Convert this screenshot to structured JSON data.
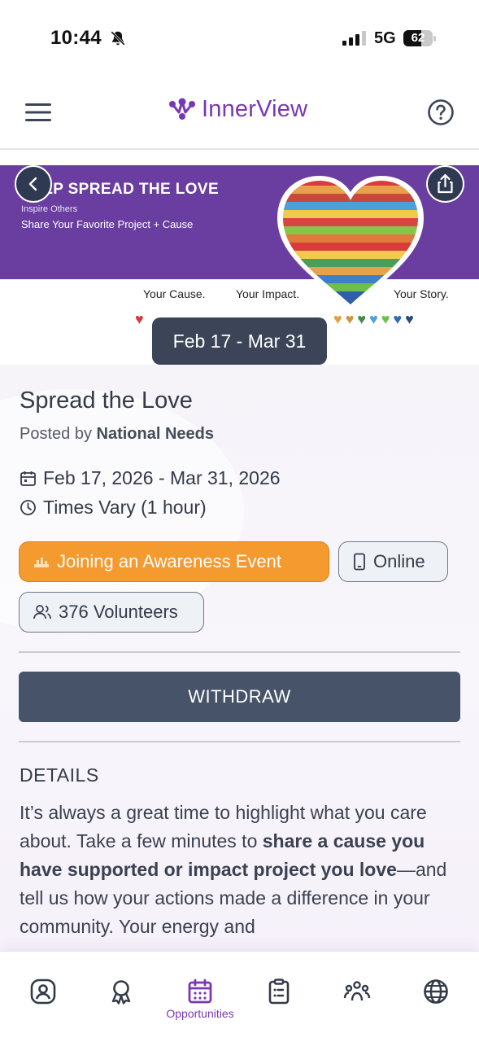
{
  "status_bar": {
    "time": "10:44",
    "network": "5G",
    "battery": "62"
  },
  "header": {
    "brand_name": "InnerView"
  },
  "hero": {
    "title": "HELP SPREAD THE LOVE",
    "subtitle": "Inspire Others",
    "tagline": "Share Your Favorite Project + Cause",
    "cause": "Your Cause.",
    "impact": "Your Impact.",
    "story": "Your Story."
  },
  "date_badge": "Feb 17 - Mar 31",
  "opportunity": {
    "title": "Spread the Love",
    "posted_prefix": "Posted by",
    "organization": "National Needs",
    "date_range": "Feb 17, 2026 - Mar 31, 2026",
    "time": "Times Vary (1 hour)",
    "category": "Joining an Awareness Event",
    "location": "Online",
    "volunteers": "376 Volunteers"
  },
  "actions": {
    "withdraw": "WITHDRAW"
  },
  "details": {
    "heading": "DETAILS",
    "p1": "It’s always a great time to highlight what you care about. Take a few minutes to ",
    "b1": "share a cause you have supported or impact project you love",
    "p2": "—and tell us how your actions made a difference in your community. Your energy and"
  },
  "nav": {
    "items": [
      {
        "icon": "profile-icon",
        "label": ""
      },
      {
        "icon": "award-icon",
        "label": ""
      },
      {
        "icon": "calendar-icon",
        "label": "Opportunities",
        "active": true
      },
      {
        "icon": "clipboard-icon",
        "label": ""
      },
      {
        "icon": "community-icon",
        "label": ""
      },
      {
        "icon": "globe-icon",
        "label": ""
      }
    ]
  },
  "colors": {
    "brand": "#7a37b5",
    "accent_orange": "#f59a2f",
    "button_dark": "#475368"
  }
}
